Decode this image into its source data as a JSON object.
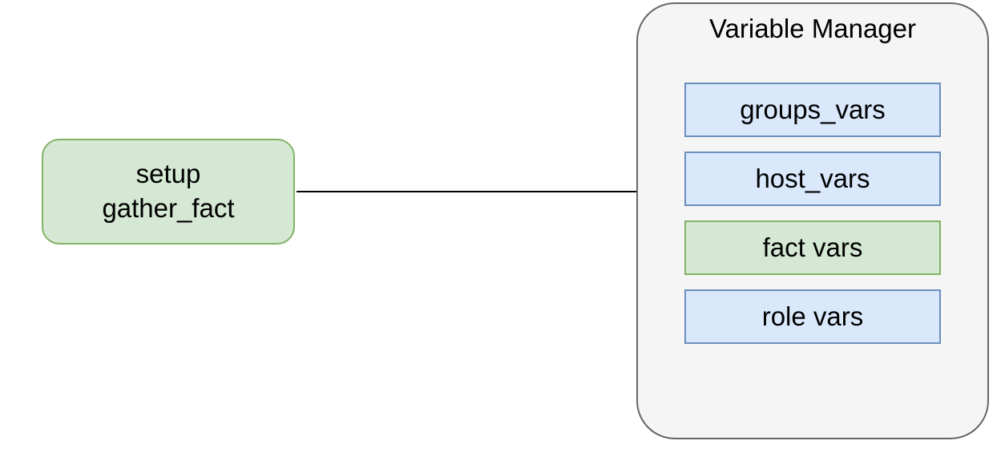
{
  "setup": {
    "line1": "setup",
    "line2": "gather_fact"
  },
  "vm": {
    "title": "Variable Manager",
    "items": [
      {
        "label": "groups_vars",
        "kind": "blue"
      },
      {
        "label": "host_vars",
        "kind": "blue"
      },
      {
        "label": "fact vars",
        "kind": "fact"
      },
      {
        "label": "role vars",
        "kind": "blue"
      }
    ]
  }
}
